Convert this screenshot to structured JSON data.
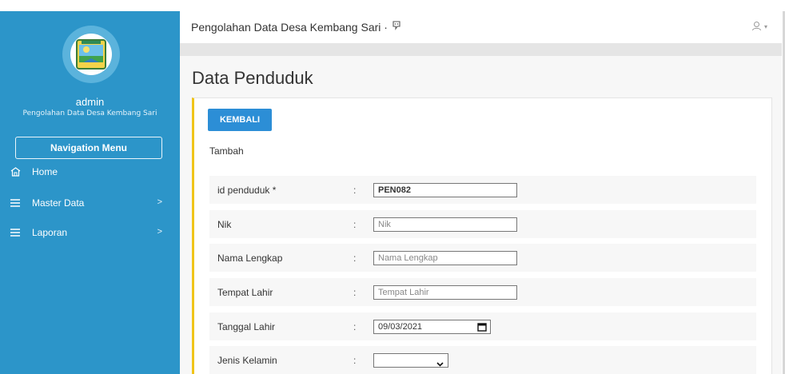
{
  "sidebar": {
    "user_name": "admin",
    "user_subtitle": "Pengolahan Data Desa Kembang Sari",
    "nav_menu_label": "Navigation Menu",
    "items": [
      {
        "label": "Home",
        "icon": "home-icon"
      },
      {
        "label": "Master Data",
        "icon": "menu-icon",
        "chevron": ">"
      },
      {
        "label": "Laporan",
        "icon": "menu-icon",
        "chevron": ">"
      }
    ],
    "logo_icon": "village-logo-icon"
  },
  "topbar": {
    "app_title": "Pengolahan Data Desa Kembang Sari ·",
    "github_icon": "github-icon",
    "user_icon": "user-icon",
    "caret": "▾"
  },
  "page": {
    "title": "Data Penduduk",
    "back_button": "KEMBALI",
    "subtitle": "Tambah"
  },
  "form": {
    "colon": ":",
    "fields": [
      {
        "label": "id penduduk *",
        "value": "PEN082",
        "placeholder": ""
      },
      {
        "label": "Nik",
        "value": "",
        "placeholder": "Nik"
      },
      {
        "label": "Nama Lengkap",
        "value": "",
        "placeholder": "Nama Lengkap"
      },
      {
        "label": "Tempat Lahir",
        "value": "",
        "placeholder": "Tempat Lahir"
      },
      {
        "label": "Tanggal Lahir",
        "value": "09/03/2021",
        "placeholder": ""
      },
      {
        "label": "Jenis Kelamin",
        "value": "",
        "placeholder": ""
      }
    ]
  },
  "colors": {
    "sidebar": "#2c95c9",
    "accent_button": "#2c8ed6",
    "panel_accent": "#f0c419"
  }
}
